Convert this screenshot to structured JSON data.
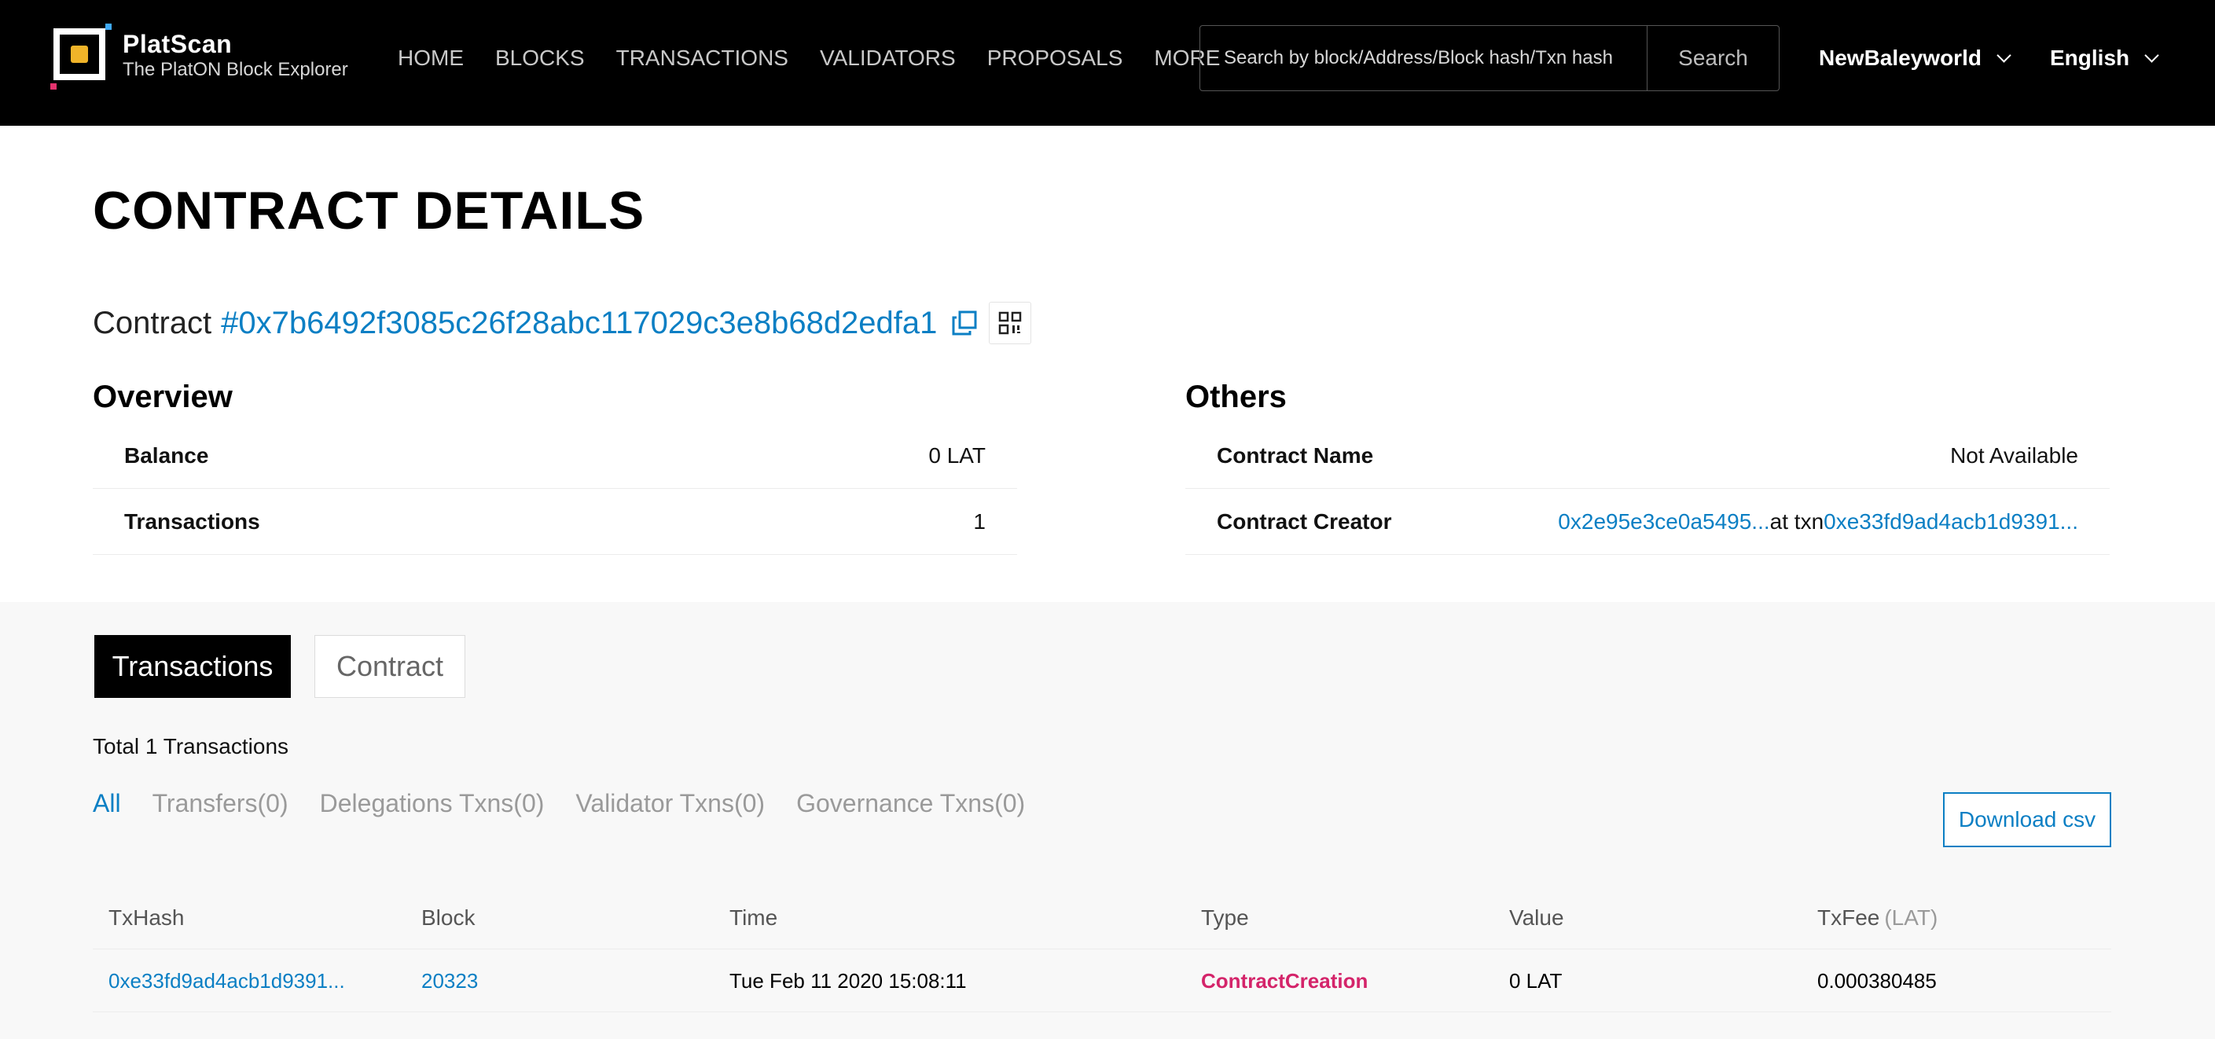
{
  "header": {
    "logo_title": "PlatScan",
    "logo_subtitle": "The PlatON Block Explorer",
    "nav": [
      "HOME",
      "BLOCKS",
      "TRANSACTIONS",
      "VALIDATORS",
      "PROPOSALS",
      "MORE"
    ],
    "search_placeholder": "Search by block/Address/Block hash/Txn hash",
    "search_button": "Search",
    "network": "NewBaleyworld",
    "language": "English"
  },
  "page": {
    "title": "CONTRACT DETAILS",
    "contract_label": "Contract",
    "contract_address": "#0x7b6492f3085c26f28abc117029c3e8b68d2edfa1"
  },
  "overview": {
    "title": "Overview",
    "rows": [
      {
        "label": "Balance",
        "value": "0 LAT"
      },
      {
        "label": "Transactions",
        "value": "1"
      }
    ]
  },
  "others": {
    "title": "Others",
    "contract_name_label": "Contract Name",
    "contract_name_value": "Not Available",
    "creator_label": "Contract Creator",
    "creator_address": "0x2e95e3ce0a5495...",
    "creator_at_txn": "at txn",
    "creator_txn": "0xe33fd9ad4acb1d9391..."
  },
  "tabs": {
    "transactions": "Transactions",
    "contract": "Contract"
  },
  "summary": "Total 1 Transactions",
  "filters": [
    "All",
    "Transfers(0)",
    "Delegations Txns(0)",
    "Validator Txns(0)",
    "Governance Txns(0)"
  ],
  "download_button": "Download csv",
  "table": {
    "columns": [
      "TxHash",
      "Block",
      "Time",
      "Type",
      "Value",
      "TxFee"
    ],
    "fee_unit": "(LAT)",
    "rows": [
      {
        "txhash": "0xe33fd9ad4acb1d9391...",
        "block": "20323",
        "time": "Tue Feb 11 2020 15:08:11",
        "type": "ContractCreation",
        "value": "0 LAT",
        "txfee": "0.000380485"
      }
    ]
  },
  "colors": {
    "accent": "#0b7fc4",
    "type_creation": "#d4246a",
    "header_bg": "#000000",
    "lower_bg": "#f8f8f8"
  }
}
